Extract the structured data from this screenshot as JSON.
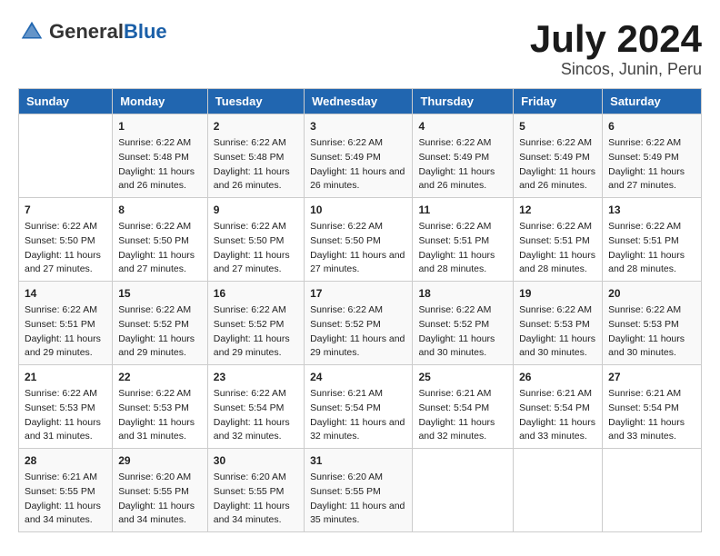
{
  "logo": {
    "general": "General",
    "blue": "Blue"
  },
  "title": "July 2024",
  "subtitle": "Sincos, Junin, Peru",
  "days": [
    "Sunday",
    "Monday",
    "Tuesday",
    "Wednesday",
    "Thursday",
    "Friday",
    "Saturday"
  ],
  "weeks": [
    [
      {
        "day": "",
        "sunrise": "",
        "sunset": "",
        "daylight": ""
      },
      {
        "day": "1",
        "sunrise": "Sunrise: 6:22 AM",
        "sunset": "Sunset: 5:48 PM",
        "daylight": "Daylight: 11 hours and 26 minutes."
      },
      {
        "day": "2",
        "sunrise": "Sunrise: 6:22 AM",
        "sunset": "Sunset: 5:48 PM",
        "daylight": "Daylight: 11 hours and 26 minutes."
      },
      {
        "day": "3",
        "sunrise": "Sunrise: 6:22 AM",
        "sunset": "Sunset: 5:49 PM",
        "daylight": "Daylight: 11 hours and 26 minutes."
      },
      {
        "day": "4",
        "sunrise": "Sunrise: 6:22 AM",
        "sunset": "Sunset: 5:49 PM",
        "daylight": "Daylight: 11 hours and 26 minutes."
      },
      {
        "day": "5",
        "sunrise": "Sunrise: 6:22 AM",
        "sunset": "Sunset: 5:49 PM",
        "daylight": "Daylight: 11 hours and 26 minutes."
      },
      {
        "day": "6",
        "sunrise": "Sunrise: 6:22 AM",
        "sunset": "Sunset: 5:49 PM",
        "daylight": "Daylight: 11 hours and 27 minutes."
      }
    ],
    [
      {
        "day": "7",
        "sunrise": "Sunrise: 6:22 AM",
        "sunset": "Sunset: 5:50 PM",
        "daylight": "Daylight: 11 hours and 27 minutes."
      },
      {
        "day": "8",
        "sunrise": "Sunrise: 6:22 AM",
        "sunset": "Sunset: 5:50 PM",
        "daylight": "Daylight: 11 hours and 27 minutes."
      },
      {
        "day": "9",
        "sunrise": "Sunrise: 6:22 AM",
        "sunset": "Sunset: 5:50 PM",
        "daylight": "Daylight: 11 hours and 27 minutes."
      },
      {
        "day": "10",
        "sunrise": "Sunrise: 6:22 AM",
        "sunset": "Sunset: 5:50 PM",
        "daylight": "Daylight: 11 hours and 27 minutes."
      },
      {
        "day": "11",
        "sunrise": "Sunrise: 6:22 AM",
        "sunset": "Sunset: 5:51 PM",
        "daylight": "Daylight: 11 hours and 28 minutes."
      },
      {
        "day": "12",
        "sunrise": "Sunrise: 6:22 AM",
        "sunset": "Sunset: 5:51 PM",
        "daylight": "Daylight: 11 hours and 28 minutes."
      },
      {
        "day": "13",
        "sunrise": "Sunrise: 6:22 AM",
        "sunset": "Sunset: 5:51 PM",
        "daylight": "Daylight: 11 hours and 28 minutes."
      }
    ],
    [
      {
        "day": "14",
        "sunrise": "Sunrise: 6:22 AM",
        "sunset": "Sunset: 5:51 PM",
        "daylight": "Daylight: 11 hours and 29 minutes."
      },
      {
        "day": "15",
        "sunrise": "Sunrise: 6:22 AM",
        "sunset": "Sunset: 5:52 PM",
        "daylight": "Daylight: 11 hours and 29 minutes."
      },
      {
        "day": "16",
        "sunrise": "Sunrise: 6:22 AM",
        "sunset": "Sunset: 5:52 PM",
        "daylight": "Daylight: 11 hours and 29 minutes."
      },
      {
        "day": "17",
        "sunrise": "Sunrise: 6:22 AM",
        "sunset": "Sunset: 5:52 PM",
        "daylight": "Daylight: 11 hours and 29 minutes."
      },
      {
        "day": "18",
        "sunrise": "Sunrise: 6:22 AM",
        "sunset": "Sunset: 5:52 PM",
        "daylight": "Daylight: 11 hours and 30 minutes."
      },
      {
        "day": "19",
        "sunrise": "Sunrise: 6:22 AM",
        "sunset": "Sunset: 5:53 PM",
        "daylight": "Daylight: 11 hours and 30 minutes."
      },
      {
        "day": "20",
        "sunrise": "Sunrise: 6:22 AM",
        "sunset": "Sunset: 5:53 PM",
        "daylight": "Daylight: 11 hours and 30 minutes."
      }
    ],
    [
      {
        "day": "21",
        "sunrise": "Sunrise: 6:22 AM",
        "sunset": "Sunset: 5:53 PM",
        "daylight": "Daylight: 11 hours and 31 minutes."
      },
      {
        "day": "22",
        "sunrise": "Sunrise: 6:22 AM",
        "sunset": "Sunset: 5:53 PM",
        "daylight": "Daylight: 11 hours and 31 minutes."
      },
      {
        "day": "23",
        "sunrise": "Sunrise: 6:22 AM",
        "sunset": "Sunset: 5:54 PM",
        "daylight": "Daylight: 11 hours and 32 minutes."
      },
      {
        "day": "24",
        "sunrise": "Sunrise: 6:21 AM",
        "sunset": "Sunset: 5:54 PM",
        "daylight": "Daylight: 11 hours and 32 minutes."
      },
      {
        "day": "25",
        "sunrise": "Sunrise: 6:21 AM",
        "sunset": "Sunset: 5:54 PM",
        "daylight": "Daylight: 11 hours and 32 minutes."
      },
      {
        "day": "26",
        "sunrise": "Sunrise: 6:21 AM",
        "sunset": "Sunset: 5:54 PM",
        "daylight": "Daylight: 11 hours and 33 minutes."
      },
      {
        "day": "27",
        "sunrise": "Sunrise: 6:21 AM",
        "sunset": "Sunset: 5:54 PM",
        "daylight": "Daylight: 11 hours and 33 minutes."
      }
    ],
    [
      {
        "day": "28",
        "sunrise": "Sunrise: 6:21 AM",
        "sunset": "Sunset: 5:55 PM",
        "daylight": "Daylight: 11 hours and 34 minutes."
      },
      {
        "day": "29",
        "sunrise": "Sunrise: 6:20 AM",
        "sunset": "Sunset: 5:55 PM",
        "daylight": "Daylight: 11 hours and 34 minutes."
      },
      {
        "day": "30",
        "sunrise": "Sunrise: 6:20 AM",
        "sunset": "Sunset: 5:55 PM",
        "daylight": "Daylight: 11 hours and 34 minutes."
      },
      {
        "day": "31",
        "sunrise": "Sunrise: 6:20 AM",
        "sunset": "Sunset: 5:55 PM",
        "daylight": "Daylight: 11 hours and 35 minutes."
      },
      {
        "day": "",
        "sunrise": "",
        "sunset": "",
        "daylight": ""
      },
      {
        "day": "",
        "sunrise": "",
        "sunset": "",
        "daylight": ""
      },
      {
        "day": "",
        "sunrise": "",
        "sunset": "",
        "daylight": ""
      }
    ]
  ]
}
